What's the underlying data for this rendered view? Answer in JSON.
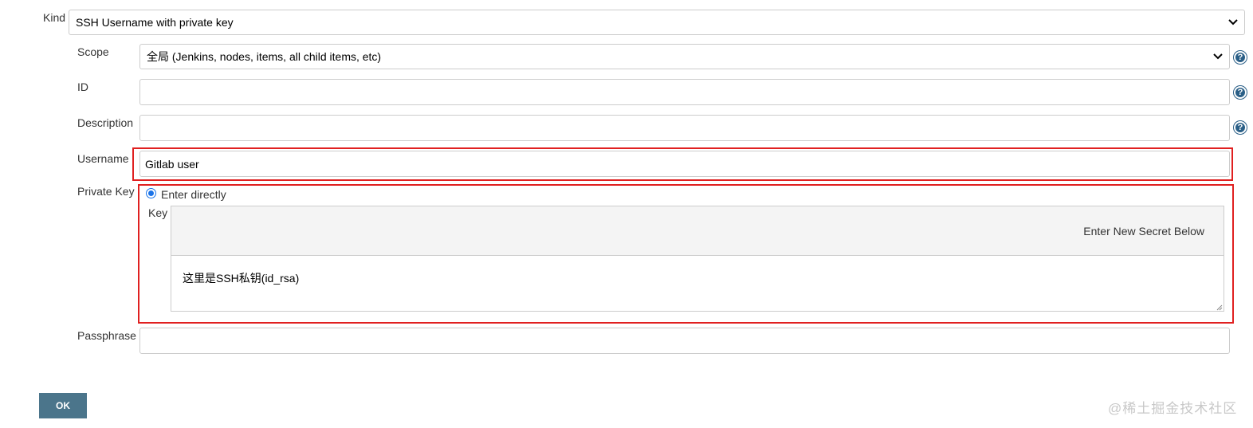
{
  "form": {
    "kind": {
      "label": "Kind",
      "value": "SSH Username with private key"
    },
    "scope": {
      "label": "Scope",
      "value": "全局 (Jenkins, nodes, items, all child items, etc)"
    },
    "id": {
      "label": "ID",
      "value": ""
    },
    "description": {
      "label": "Description",
      "value": ""
    },
    "username": {
      "label": "Username",
      "value": "Gitlab user"
    },
    "private_key": {
      "label": "Private Key",
      "option_label": "Enter directly",
      "option_selected": true,
      "key_label": "Key",
      "secret_header": "Enter New Secret Below",
      "key_value": "这里是SSH私钥(id_rsa)"
    },
    "passphrase": {
      "label": "Passphrase",
      "value": ""
    }
  },
  "help_icon_glyph": "?",
  "buttons": {
    "ok_label": "OK"
  },
  "watermark": "@稀土掘金技术社区",
  "colors": {
    "highlight_border": "#e02020",
    "ok_button": "#4b758b",
    "help_icon": "#2a5f87",
    "radio_accent": "#1a73e8"
  }
}
